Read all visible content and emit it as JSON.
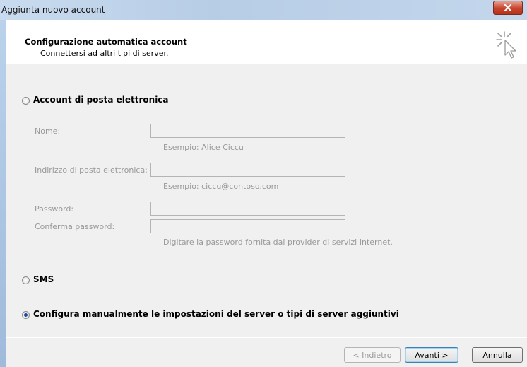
{
  "window": {
    "title": "Aggiunta nuovo account"
  },
  "header": {
    "title": "Configurazione automatica account",
    "subtitle": "Connettersi ad altri tipi di server."
  },
  "options": {
    "email_account": "Account di posta elettronica",
    "sms": "SMS",
    "manual": "Configura manualmente le impostazioni del server o tipi di server aggiuntivi",
    "selected": "manual"
  },
  "form": {
    "name_label": "Nome:",
    "name_value": "",
    "name_example": "Esempio: Alice Ciccu",
    "email_label": "Indirizzo di posta elettronica:",
    "email_value": "",
    "email_example": "Esempio: ciccu@contoso.com",
    "password_label": "Password:",
    "password_value": "",
    "confirm_label": "Conferma password:",
    "confirm_value": "",
    "password_hint": "Digitare la password fornita dal provider di servizi Internet."
  },
  "buttons": {
    "back": "< Indietro",
    "next": "Avanti >",
    "cancel": "Annulla"
  },
  "colors": {
    "disabled_text": "#999999",
    "selected_radio": "#1b4a9c",
    "close_button": "#c7432c"
  }
}
